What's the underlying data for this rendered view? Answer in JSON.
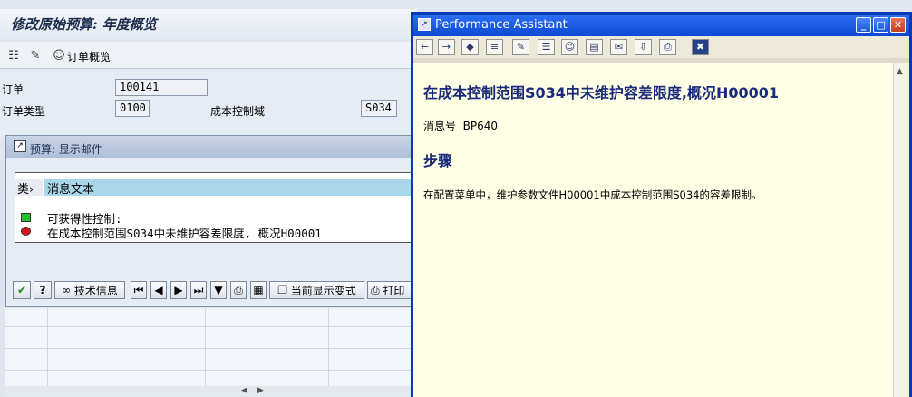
{
  "main": {
    "title": "修改原始预算: 年度概览",
    "toolbar": {
      "order_overview": "订单概览"
    },
    "form": {
      "order_label": "订单",
      "order_value": "100141",
      "order_type_label": "订单类型",
      "order_type_value": "0100",
      "controlling_area_label": "成本控制域",
      "controlling_area_value": "S034"
    }
  },
  "popup": {
    "title": "预算: 显示邮件",
    "table": {
      "col_type": "类",
      "col_text": "消息文本",
      "rows": [
        {
          "status": "green",
          "text": "可获得性控制:"
        },
        {
          "status": "red",
          "text": "在成本控制范围S034中未维护容差限度, 概况H00001"
        }
      ]
    },
    "buttons": {
      "tech_info": "技术信息",
      "current_display_variant": "当前显示变式",
      "print": "打印"
    }
  },
  "assistant": {
    "window_title": "Performance Assistant",
    "heading": "在成本控制范围S034中未维护容差限度,概况H00001",
    "msg_no_label": "消息号",
    "msg_no": "BP640",
    "steps_heading": "步骤",
    "body": "在配置菜单中，维护参数文件H00001中成本控制范围S034的容差限制。"
  },
  "colors": {
    "pa_title_bar": "#0d49d4",
    "pa_content_bg": "#ffffe6",
    "popup_header": "#a8d7ea",
    "status_green": "#22c32a",
    "status_red": "#d8141b"
  }
}
